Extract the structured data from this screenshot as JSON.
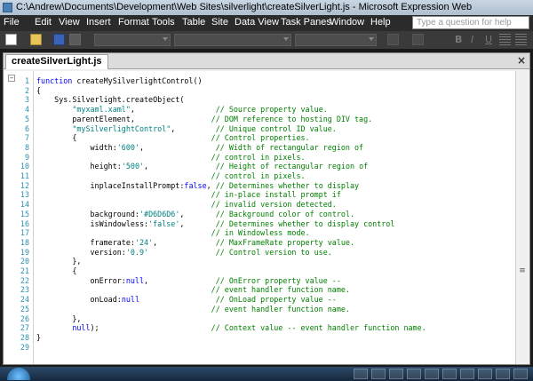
{
  "window": {
    "title": "C:\\Andrew\\Documents\\Development\\Web Sites\\silverlight\\createSilverLight.js - Microsoft Expression Web"
  },
  "menubar": {
    "items": [
      {
        "label": "File"
      },
      {
        "label": "Edit"
      },
      {
        "label": "View"
      },
      {
        "label": "Insert"
      },
      {
        "label": "Format"
      },
      {
        "label": "Tools"
      },
      {
        "label": "Table"
      },
      {
        "label": "Site"
      },
      {
        "label": "Data View"
      },
      {
        "label": "Task Panes"
      },
      {
        "label": "Window"
      },
      {
        "label": "Help"
      }
    ],
    "help_placeholder": "Type a question for help"
  },
  "document": {
    "tab_label": "createSilverLight.js",
    "close_symbol": "×",
    "outline_symbol": "−",
    "scroll_symbol": "≡",
    "lines": [
      {
        "n": "1",
        "tokens": [
          {
            "t": "function",
            "c": "kw"
          },
          {
            "t": " createMySilverlightControl()",
            "c": "plain"
          }
        ]
      },
      {
        "n": "2",
        "tokens": [
          {
            "t": "{",
            "c": "plain"
          }
        ]
      },
      {
        "n": "3",
        "tokens": [
          {
            "t": "    Sys.Silverlight.createObject(",
            "c": "plain"
          }
        ]
      },
      {
        "n": "4",
        "tokens": [
          {
            "t": "        ",
            "c": "plain"
          },
          {
            "t": "\"myxaml.xaml\"",
            "c": "strteal"
          },
          {
            "t": ",                  ",
            "c": "plain"
          },
          {
            "t": "// Source property value.",
            "c": "cm"
          }
        ]
      },
      {
        "n": "5",
        "tokens": [
          {
            "t": "        parentElement,                 ",
            "c": "plain"
          },
          {
            "t": "// DOM reference to hosting DIV tag.",
            "c": "cm"
          }
        ]
      },
      {
        "n": "6",
        "tokens": [
          {
            "t": "        ",
            "c": "plain"
          },
          {
            "t": "\"mySilverlightControl\"",
            "c": "strteal"
          },
          {
            "t": ",         ",
            "c": "plain"
          },
          {
            "t": "// Unique control ID value.",
            "c": "cm"
          }
        ]
      },
      {
        "n": "7",
        "tokens": [
          {
            "t": "        {                              ",
            "c": "plain"
          },
          {
            "t": "// Control properties.",
            "c": "cm"
          }
        ]
      },
      {
        "n": "8",
        "tokens": [
          {
            "t": "            width:",
            "c": "plain"
          },
          {
            "t": "'600'",
            "c": "strteal"
          },
          {
            "t": ",                ",
            "c": "plain"
          },
          {
            "t": "// Width of rectangular region of",
            "c": "cm"
          }
        ]
      },
      {
        "n": "9",
        "tokens": [
          {
            "t": "                                       ",
            "c": "plain"
          },
          {
            "t": "// control in pixels.",
            "c": "cm"
          }
        ]
      },
      {
        "n": "10",
        "tokens": [
          {
            "t": "            height:",
            "c": "plain"
          },
          {
            "t": "'500'",
            "c": "strteal"
          },
          {
            "t": ",               ",
            "c": "plain"
          },
          {
            "t": "// Height of rectangular region of",
            "c": "cm"
          }
        ]
      },
      {
        "n": "11",
        "tokens": [
          {
            "t": "                                       ",
            "c": "plain"
          },
          {
            "t": "// control in pixels.",
            "c": "cm"
          }
        ]
      },
      {
        "n": "12",
        "tokens": [
          {
            "t": "            inplaceInstallPrompt:",
            "c": "plain"
          },
          {
            "t": "false",
            "c": "kw"
          },
          {
            "t": ", ",
            "c": "plain"
          },
          {
            "t": "// Determines whether to display",
            "c": "cm"
          }
        ]
      },
      {
        "n": "13",
        "tokens": [
          {
            "t": "                                       ",
            "c": "plain"
          },
          {
            "t": "// in-place install prompt if",
            "c": "cm"
          }
        ]
      },
      {
        "n": "14",
        "tokens": [
          {
            "t": "                                       ",
            "c": "plain"
          },
          {
            "t": "// invalid version detected.",
            "c": "cm"
          }
        ]
      },
      {
        "n": "15",
        "tokens": [
          {
            "t": "            background:",
            "c": "plain"
          },
          {
            "t": "'#D6D6D6'",
            "c": "strteal"
          },
          {
            "t": ",       ",
            "c": "plain"
          },
          {
            "t": "// Background color of control.",
            "c": "cm"
          }
        ]
      },
      {
        "n": "16",
        "tokens": [
          {
            "t": "            isWindowless:",
            "c": "plain"
          },
          {
            "t": "'false'",
            "c": "strteal"
          },
          {
            "t": ",       ",
            "c": "plain"
          },
          {
            "t": "// Determines whether to display control",
            "c": "cm"
          }
        ]
      },
      {
        "n": "17",
        "tokens": [
          {
            "t": "                                       ",
            "c": "plain"
          },
          {
            "t": "// in Windowless mode.",
            "c": "cm"
          }
        ]
      },
      {
        "n": "18",
        "tokens": [
          {
            "t": "            framerate:",
            "c": "plain"
          },
          {
            "t": "'24'",
            "c": "strteal"
          },
          {
            "t": ",             ",
            "c": "plain"
          },
          {
            "t": "// MaxFrameRate property value.",
            "c": "cm"
          }
        ]
      },
      {
        "n": "19",
        "tokens": [
          {
            "t": "            version:",
            "c": "plain"
          },
          {
            "t": "'0.9'",
            "c": "strteal"
          },
          {
            "t": "               ",
            "c": "plain"
          },
          {
            "t": "// Control version to use.",
            "c": "cm"
          }
        ]
      },
      {
        "n": "20",
        "tokens": [
          {
            "t": "        },",
            "c": "plain"
          }
        ]
      },
      {
        "n": "21",
        "tokens": [
          {
            "t": "        {",
            "c": "plain"
          }
        ]
      },
      {
        "n": "22",
        "tokens": [
          {
            "t": "            onError:",
            "c": "plain"
          },
          {
            "t": "null",
            "c": "kw"
          },
          {
            "t": ",               ",
            "c": "plain"
          },
          {
            "t": "// OnError property value --",
            "c": "cm"
          }
        ]
      },
      {
        "n": "23",
        "tokens": [
          {
            "t": "                                       ",
            "c": "plain"
          },
          {
            "t": "// event handler function name.",
            "c": "cm"
          }
        ]
      },
      {
        "n": "24",
        "tokens": [
          {
            "t": "            onLoad:",
            "c": "plain"
          },
          {
            "t": "null",
            "c": "kw"
          },
          {
            "t": "                 ",
            "c": "plain"
          },
          {
            "t": "// OnLoad property value --",
            "c": "cm"
          }
        ]
      },
      {
        "n": "25",
        "tokens": [
          {
            "t": "                                       ",
            "c": "plain"
          },
          {
            "t": "// event handler function name.",
            "c": "cm"
          }
        ]
      },
      {
        "n": "26",
        "tokens": [
          {
            "t": "        },",
            "c": "plain"
          }
        ]
      },
      {
        "n": "27",
        "tokens": [
          {
            "t": "        ",
            "c": "plain"
          },
          {
            "t": "null",
            "c": "kw"
          },
          {
            "t": ");                         ",
            "c": "plain"
          },
          {
            "t": "// Context value -- event handler function name.",
            "c": "cm"
          }
        ]
      },
      {
        "n": "28",
        "tokens": [
          {
            "t": "}",
            "c": "plain"
          }
        ]
      },
      {
        "n": "29",
        "tokens": []
      }
    ]
  },
  "toolbar": {
    "glyphs": [
      "B",
      "I",
      "U"
    ]
  },
  "colors": {
    "keyword": "#0000ff",
    "string": "#008080",
    "comment": "#008000",
    "line_number": "#2b91af"
  }
}
